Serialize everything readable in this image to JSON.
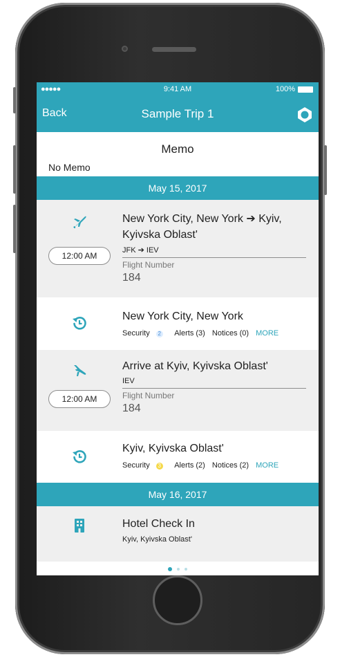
{
  "device": {
    "frame": "iPhone"
  },
  "status_bar": {
    "signal": "●●●●● ",
    "time": "9:41 AM",
    "battery": "100%"
  },
  "navbar": {
    "back_label": "Back",
    "title": "Sample Trip 1",
    "logo_icon": "app-logo-icon"
  },
  "memo": {
    "label": "Memo",
    "value": "No Memo"
  },
  "days": [
    {
      "date": "May 15, 2017",
      "items": [
        {
          "type": "departure",
          "icon": "plane-takeoff-icon",
          "time": "12:00 AM",
          "title_line1": "New York City, New York ➔ Kyiv,",
          "title_line2": "Kyivska Oblast'",
          "airports": "JFK ➔ IEV",
          "flight_number_label": "Flight Number",
          "flight_number": "184"
        },
        {
          "type": "advisory",
          "icon": "clock-refresh-icon",
          "place": "New York City, New York",
          "security_label": "Security",
          "security_level": "2",
          "alerts": "Alerts (3)",
          "notices": "Notices (0)",
          "more": "MORE"
        },
        {
          "type": "arrival",
          "icon": "plane-landing-icon",
          "time": "12:00 AM",
          "title": "Arrive at Kyiv, Kyivska Oblast'",
          "airport": "IEV",
          "flight_number_label": "Flight Number",
          "flight_number": "184"
        },
        {
          "type": "advisory",
          "icon": "clock-refresh-icon",
          "place": "Kyiv, Kyivska Oblast'",
          "security_label": "Security",
          "security_level": "3",
          "alerts": "Alerts (2)",
          "notices": "Notices (2)",
          "more": "MORE"
        }
      ]
    },
    {
      "date": "May 16, 2017",
      "items": [
        {
          "type": "hotel",
          "icon": "hotel-icon",
          "title": "Hotel Check In",
          "location": "Kyiv, Kyivska Oblast'"
        }
      ]
    }
  ],
  "pager": {
    "pages": 3,
    "current": 1
  },
  "colors": {
    "accent": "#2ea5ba",
    "row_gray": "#efefef",
    "link": "#2ea5ba",
    "security_blue": "#4a8fd4",
    "security_yellow": "#f5d94a"
  }
}
